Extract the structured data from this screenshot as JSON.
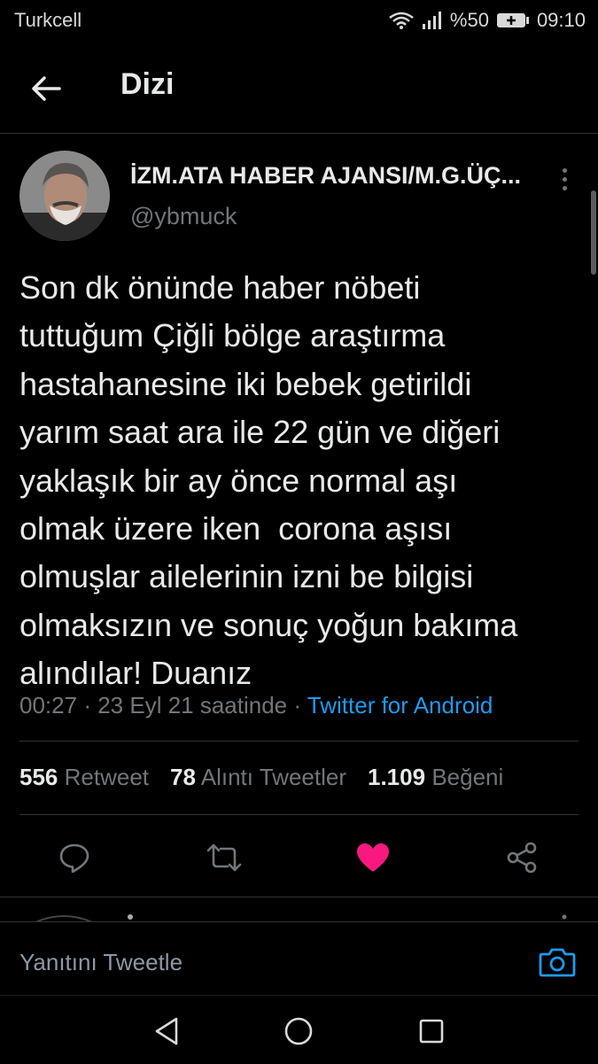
{
  "status_bar": {
    "carrier": "Turkcell",
    "battery": "%50",
    "time": "09:10"
  },
  "header": {
    "title": "Dizi"
  },
  "tweet": {
    "author_name": "İZM.ATA HABER AJANSI/M.G.ÜÇ...",
    "author_handle": "@ybmuck",
    "text_lines": [
      "Son dk önünde haber nöbeti",
      "tuttuğum Çiğli bölge araştırma",
      "hastahanesine iki bebek getirildi",
      "yarım saat ara ile 22 gün ve diğeri",
      "yaklaşık bir ay önce normal aşı",
      "olmak üzere iken  corona aşısı",
      "olmuşlar ailelerinin izni be bilgisi",
      "olmaksızın ve sonuç yoğun bakıma",
      "alındılar! Duanız"
    ],
    "time": "00:27",
    "date": "23 Eyl 21 saatinde",
    "source": "Twitter for Android",
    "stats": {
      "retweets_count": "556",
      "retweets_label": "Retweet",
      "quotes_count": "78",
      "quotes_label": "Alıntı Tweetler",
      "likes_count": "1.109",
      "likes_label": "Beğeni"
    },
    "liked": true
  },
  "reply_bar": {
    "placeholder": "Yanıtını Tweetle"
  },
  "colors": {
    "accent": "#1d9bf0",
    "like": "#f91880",
    "background": "#000000",
    "muted": "#71767b"
  },
  "icons": {
    "back": "arrow-left-icon",
    "reply": "comment-icon",
    "retweet": "retweet-icon",
    "like": "heart-icon",
    "share": "share-icon",
    "camera": "camera-icon"
  }
}
